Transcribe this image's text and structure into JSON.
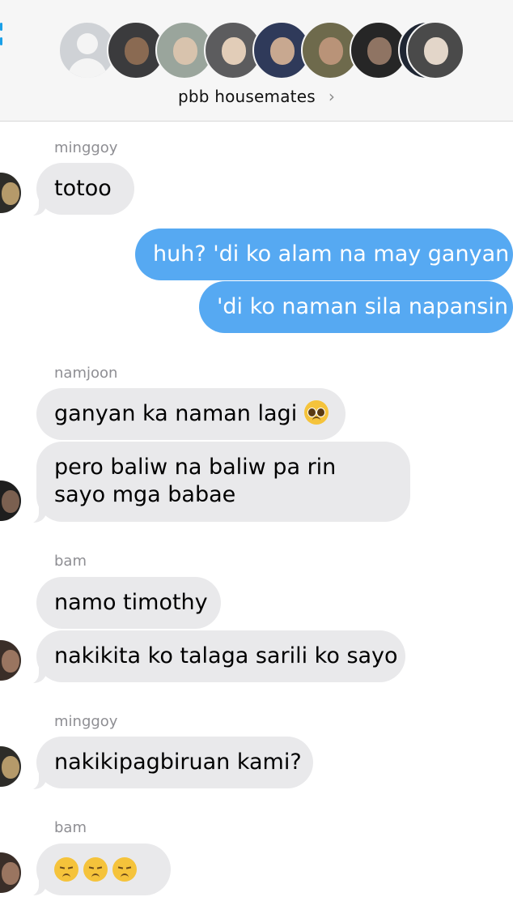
{
  "header": {
    "group_name": "pbb housemates",
    "chevron": "›",
    "avatars": [
      {
        "name": "default-avatar",
        "color": "#cfd2d6"
      },
      {
        "name": "member-avatar-1",
        "color": "#3b3b3d"
      },
      {
        "name": "member-avatar-2",
        "color": "#9aa59c"
      },
      {
        "name": "member-avatar-3",
        "color": "#5c5c5e"
      },
      {
        "name": "member-avatar-4",
        "color": "#2f3a5a"
      },
      {
        "name": "member-avatar-5",
        "color": "#6e6a4c"
      },
      {
        "name": "member-avatar-6",
        "color": "#262626"
      },
      {
        "name": "member-avatar-7",
        "color": "#1f2633"
      },
      {
        "name": "member-avatar-8",
        "color": "#4a4a4a"
      }
    ]
  },
  "messages": {
    "s1": "minggoy",
    "m1": "totoo",
    "o1": "huh? 'di ko alam na may ganyan",
    "o2": "'di ko naman sila napansin",
    "s2": "namjoon",
    "m2": "ganyan ka naman lagi",
    "m3": "pero baliw na baliw pa rin sayo mga babae",
    "s3": "bam",
    "m4": "namo timothy",
    "m5": "nakikita ko talaga sarili ko sayo",
    "s4": "minggoy",
    "m6": "nakikipagbiruan kami?",
    "s5": "bam",
    "m7_emoji": "pensive-face-emoji x3"
  },
  "colors": {
    "incoming_bubble": "#e9e9eb",
    "outgoing_bubble": "#56a9f2",
    "sender_label": "#8e8e93"
  }
}
